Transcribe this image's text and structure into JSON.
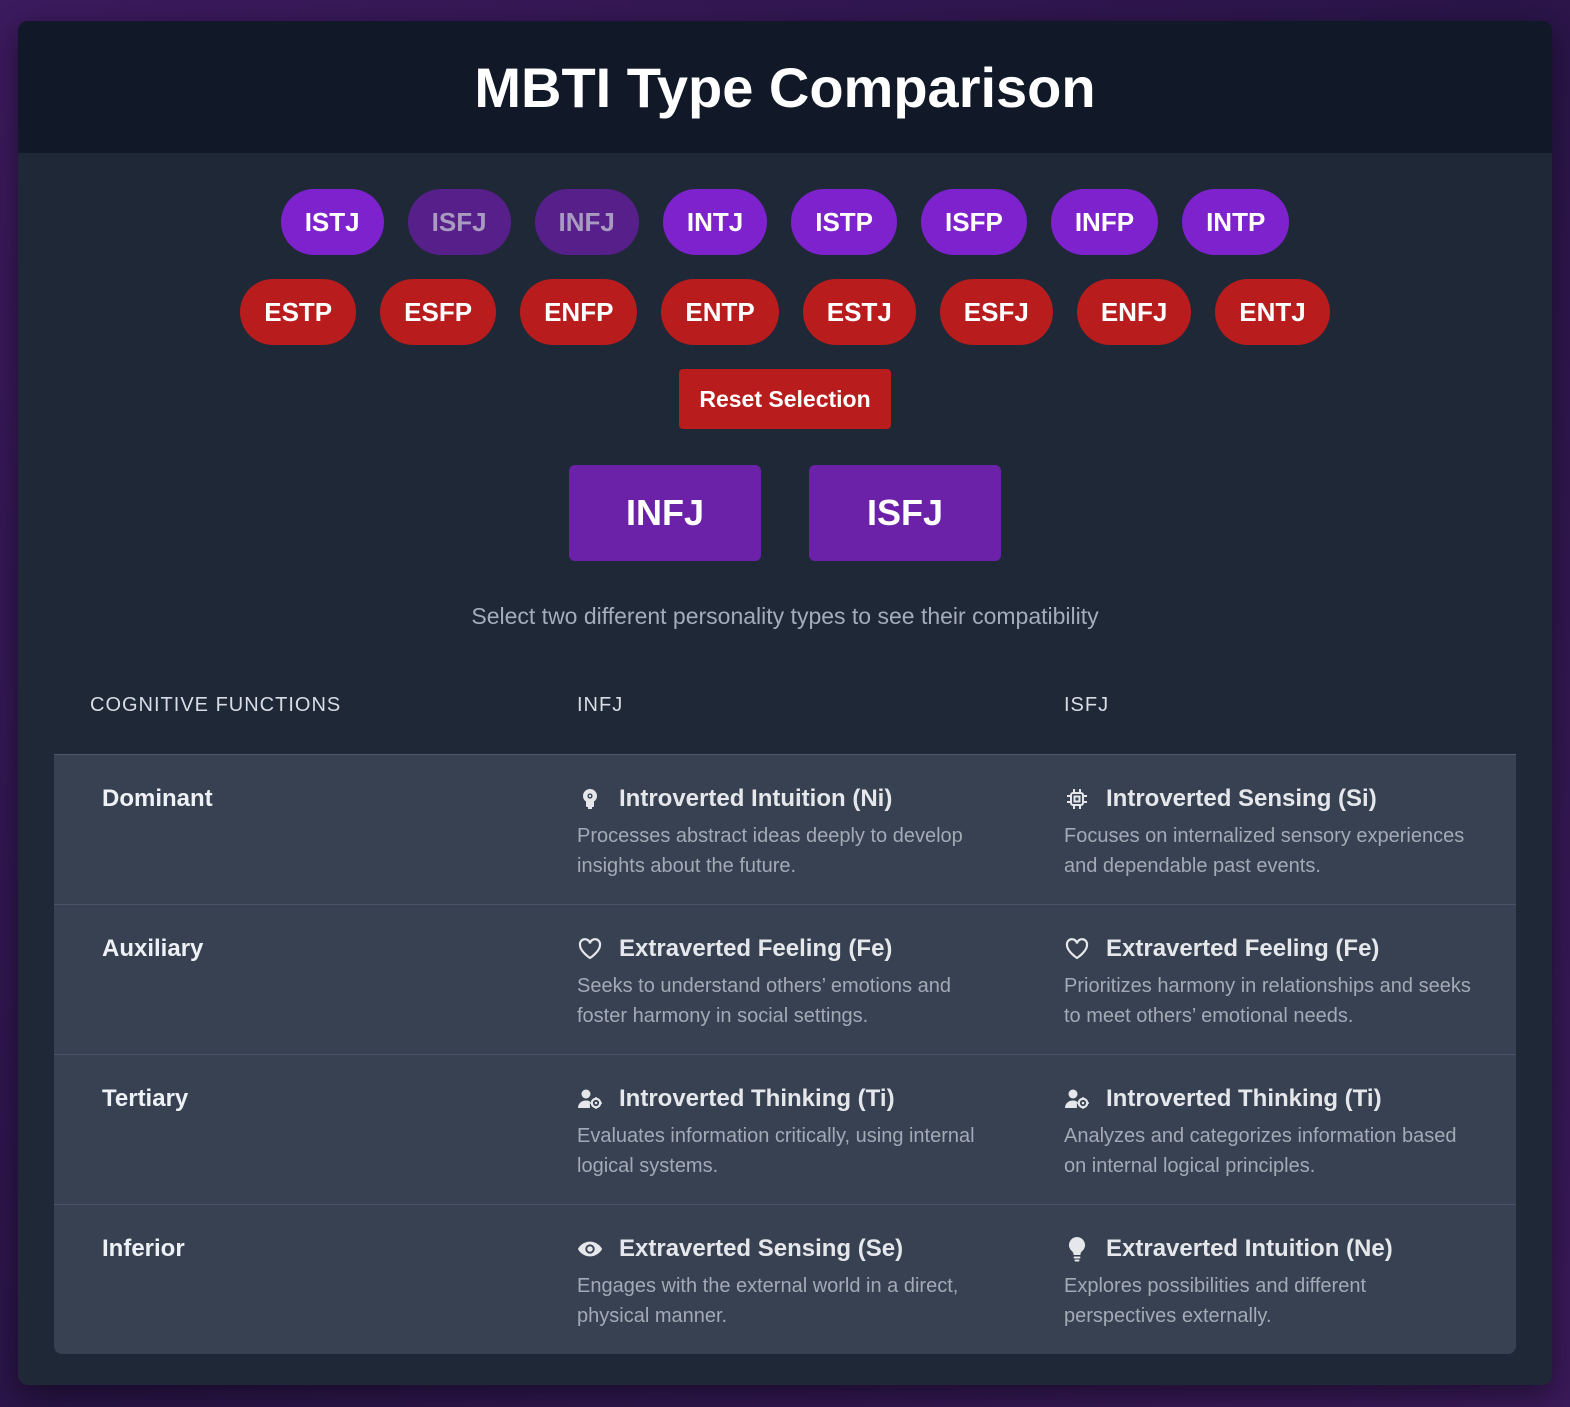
{
  "title": "MBTI Type Comparison",
  "introverted_types": [
    {
      "label": "ISTJ",
      "selected": false
    },
    {
      "label": "ISFJ",
      "selected": true
    },
    {
      "label": "INFJ",
      "selected": true
    },
    {
      "label": "INTJ",
      "selected": false
    },
    {
      "label": "ISTP",
      "selected": false
    },
    {
      "label": "ISFP",
      "selected": false
    },
    {
      "label": "INFP",
      "selected": false
    },
    {
      "label": "INTP",
      "selected": false
    }
  ],
  "extraverted_types": [
    {
      "label": "ESTP"
    },
    {
      "label": "ESFP"
    },
    {
      "label": "ENFP"
    },
    {
      "label": "ENTP"
    },
    {
      "label": "ESTJ"
    },
    {
      "label": "ESFJ"
    },
    {
      "label": "ENFJ"
    },
    {
      "label": "ENTJ"
    }
  ],
  "reset_label": "Reset Selection",
  "selected": {
    "first": "INFJ",
    "second": "ISFJ"
  },
  "hint": "Select two different personality types to see their compatibility",
  "table": {
    "headers": [
      "Cognitive Functions",
      "INFJ",
      "ISFJ"
    ],
    "rows": [
      {
        "position": "Dominant",
        "a": {
          "icon": "brain-icon",
          "name": "Introverted Intuition (Ni)",
          "desc": "Processes abstract ideas deeply to develop insights about the future."
        },
        "b": {
          "icon": "chip-icon",
          "name": "Introverted Sensing (Si)",
          "desc": "Focuses on internalized sensory experiences and dependable past events."
        }
      },
      {
        "position": "Auxiliary",
        "a": {
          "icon": "heart-icon",
          "name": "Extraverted Feeling (Fe)",
          "desc": "Seeks to understand others’ emotions and foster harmony in social settings."
        },
        "b": {
          "icon": "heart-icon",
          "name": "Extraverted Feeling (Fe)",
          "desc": "Prioritizes harmony in relationships and seeks to meet others’ emotional needs."
        }
      },
      {
        "position": "Tertiary",
        "a": {
          "icon": "user-gear-icon",
          "name": "Introverted Thinking (Ti)",
          "desc": "Evaluates information critically, using internal logical systems."
        },
        "b": {
          "icon": "user-gear-icon",
          "name": "Introverted Thinking (Ti)",
          "desc": "Analyzes and categorizes information based on internal logical principles."
        }
      },
      {
        "position": "Inferior",
        "a": {
          "icon": "eye-icon",
          "name": "Extraverted Sensing (Se)",
          "desc": "Engages with the external world in a direct, physical manner."
        },
        "b": {
          "icon": "lightbulb-icon",
          "name": "Extraverted Intuition (Ne)",
          "desc": "Explores possibilities and different perspectives externally."
        }
      }
    ]
  },
  "colors": {
    "introverted": "#7e22ce",
    "introverted_selected": "#561f8a",
    "extraverted": "#b91c1c",
    "selected_box": "#6b21a8"
  }
}
